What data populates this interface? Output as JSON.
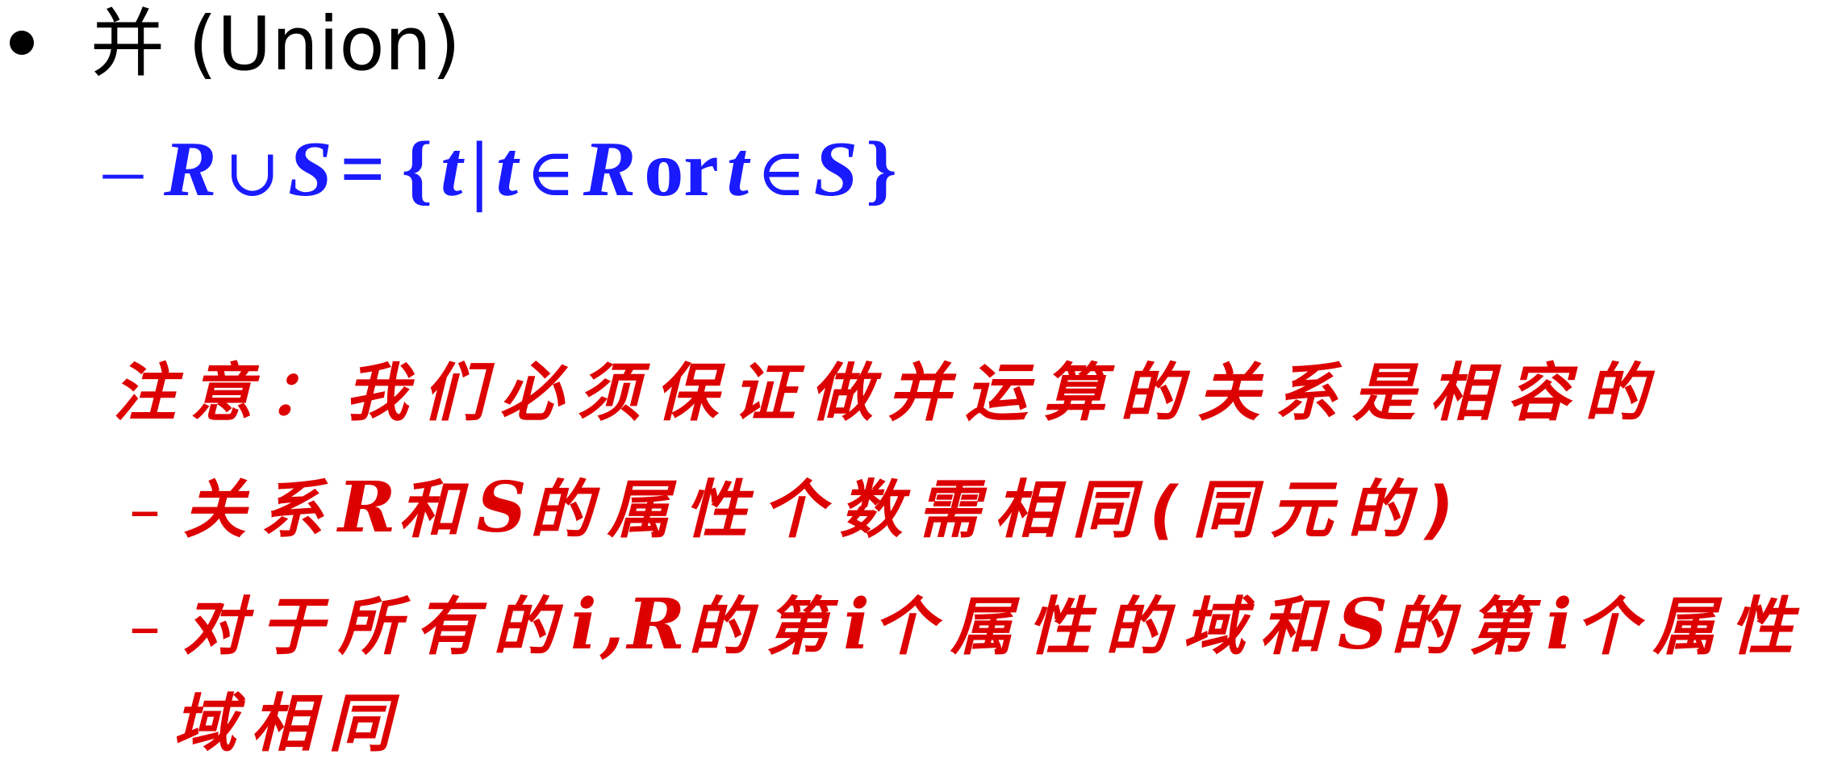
{
  "heading": {
    "text": "并 (Union)"
  },
  "formula": {
    "dash": "–",
    "R1": "R",
    "union": "∪",
    "S1": "S",
    "eq": "=",
    "lbrace": "{",
    "t1": "t",
    "bar": "|",
    "t2": "t",
    "in1": "∈",
    "R2": "R",
    "or": "or",
    "t3": "t",
    "in2": "∈",
    "S2": "S",
    "rbrace": "}"
  },
  "notes": {
    "head": "注意：我们必须保证做并运算的关系是相容的",
    "item1": {
      "dash": "–",
      "p1": "关系",
      "R": "R",
      "p2": "和",
      "S": "S",
      "p3": "的属性个数需相同(同元的)"
    },
    "item2": {
      "dash": "–",
      "p1": "对于所有的",
      "i1": "i,",
      "R": "R",
      "p2": "的第",
      "i2": "i",
      "p3": "个属性的域和",
      "S": "S",
      "p4": "的第",
      "i3": "i",
      "p5": "个属性"
    },
    "item3": "域相同"
  }
}
